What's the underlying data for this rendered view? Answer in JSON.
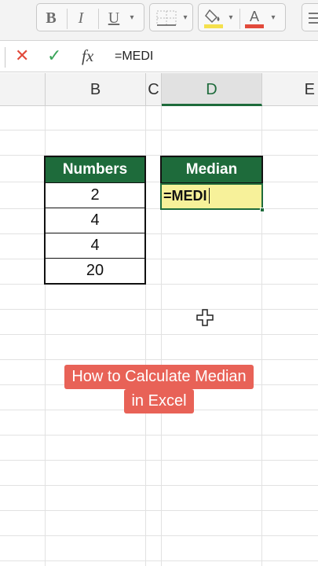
{
  "ribbon": {
    "bold": "B",
    "italic": "I",
    "underline": "U",
    "caret": "▾"
  },
  "formula_bar": {
    "cancel_symbol": "✕",
    "enter_symbol": "✓",
    "fx_label": "fx",
    "content": "=MEDI"
  },
  "columns": [
    "B",
    "C",
    "D",
    "E"
  ],
  "active_column": "D",
  "numbers_table": {
    "header": "Numbers",
    "values": [
      "2",
      "4",
      "4",
      "20"
    ]
  },
  "median_table": {
    "header": "Median",
    "input_value": "=MEDI"
  },
  "caption": {
    "line1": "How to Calculate Median",
    "line2": "in Excel"
  },
  "colors": {
    "header_green": "#1e6b3b",
    "input_yellow": "#f7f19a",
    "caption_red": "#e86257",
    "cancel_red": "#e24a3b",
    "enter_green": "#3aa55a"
  }
}
